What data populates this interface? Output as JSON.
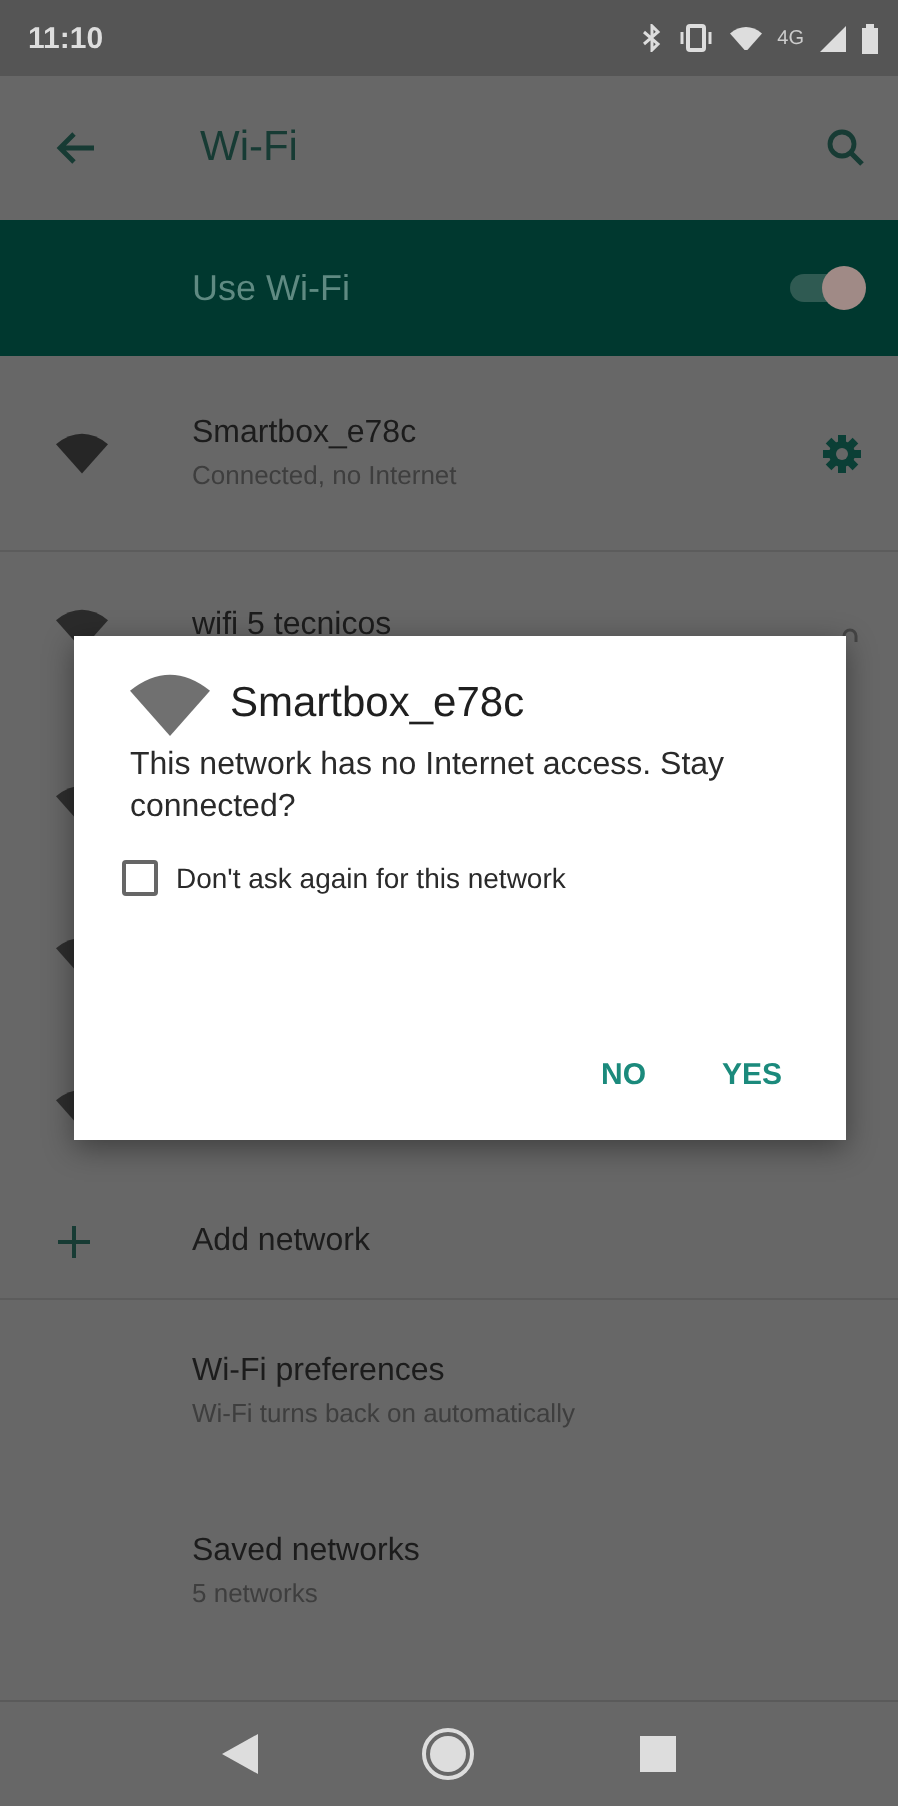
{
  "status_bar": {
    "time": "11:10",
    "network_type": "4G"
  },
  "toolbar": {
    "title": "Wi-Fi"
  },
  "master_switch": {
    "label": "Use Wi-Fi",
    "on": true
  },
  "networks": [
    {
      "name": "Smartbox_e78c",
      "subtitle": "Connected, no Internet",
      "kind": "connected"
    },
    {
      "name": "wifi 5 tecnicos",
      "kind": "locked"
    }
  ],
  "add_network": {
    "label": "Add network"
  },
  "settings": [
    {
      "title": "Wi-Fi preferences",
      "subtitle": "Wi-Fi turns back on automatically"
    },
    {
      "title": "Saved networks",
      "subtitle": "5 networks"
    }
  ],
  "dialog": {
    "title": "Smartbox_e78c",
    "message": "This network has no Internet access. Stay connected?",
    "checkbox": {
      "label": "Don't ask again for this network",
      "checked": false
    },
    "buttons": [
      "NO",
      "YES"
    ]
  }
}
